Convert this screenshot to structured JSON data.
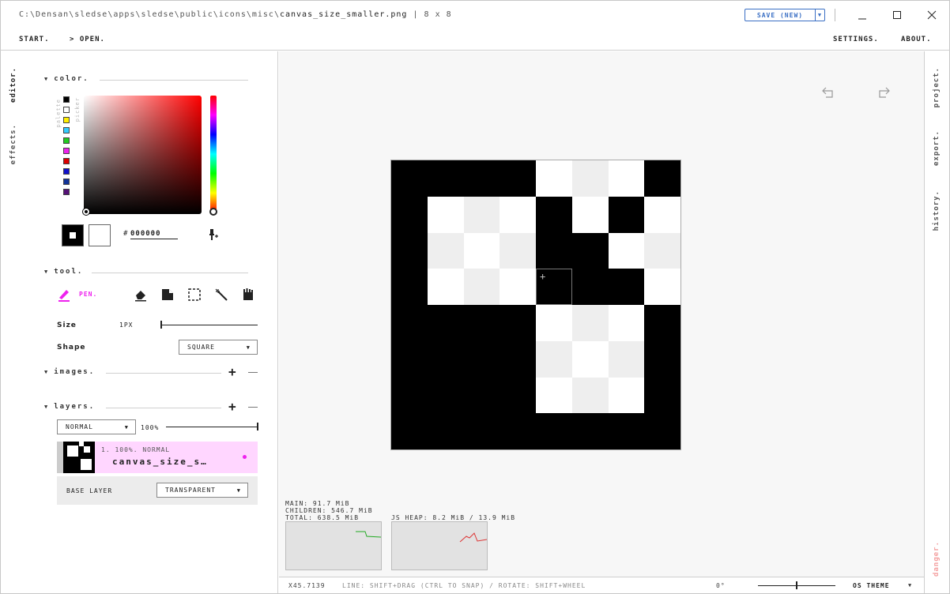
{
  "title": {
    "path_prefix": "C:\\Densan\\sledse\\apps\\sledse\\public\\icons\\misc\\",
    "filename": "canvas_size_smaller.png",
    "dimensions": "| 8 x 8"
  },
  "save": {
    "label": "SAVE (NEW)"
  },
  "window": {
    "minimize": "—",
    "maximize": "☐",
    "close": "✕"
  },
  "menu": {
    "start": "START.",
    "open": "> OPEN.",
    "settings": "SETTINGS.",
    "about": "ABOUT."
  },
  "left_nav": {
    "editor": "editor.",
    "effects": "effects."
  },
  "right_nav": {
    "project": "project.",
    "export": "export.",
    "history": "history.",
    "danger": "danger."
  },
  "color": {
    "header": "color.",
    "palette_label": "palette",
    "picker_label": "picker",
    "hex_prefix": "#",
    "hex_value": "000000",
    "palette": [
      "#000000",
      "#ffffff",
      "#ffee00",
      "#33ccff",
      "#22cc22",
      "#ee22ee",
      "#dd0000",
      "#1111cc",
      "#113399",
      "#551177"
    ]
  },
  "tool": {
    "header": "tool.",
    "active_label": "PEN.",
    "size_label": "Size",
    "size_value": "1PX",
    "shape_label": "Shape",
    "shape_value": "SQUARE"
  },
  "images": {
    "header": "images."
  },
  "layers": {
    "header": "layers.",
    "blend_mode": "NORMAL",
    "opacity": "100%",
    "layer_meta": "1. 100%. NORMAL",
    "layer_name": "canvas_size_s…",
    "base_label": "BASE LAYER",
    "base_value": "TRANSPARENT"
  },
  "memory": {
    "main": "MAIN: 91.7 MiB",
    "children": "CHILDREN: 546.7 MiB",
    "total": "TOTAL: 638.5 MiB",
    "heap": "JS HEAP: 8.2 MiB / 13.9 MiB"
  },
  "status": {
    "zoom": "X45.7139",
    "hint": "LINE: SHIFT+DRAG (CTRL TO SNAP) / ROTATE: SHIFT+WHEEL",
    "rotation": "0°",
    "theme": "OS THEME"
  },
  "pixel_grid": [
    [
      "#000",
      "#000",
      "#000",
      "#000",
      "#fff",
      "#eee",
      "#fff",
      "#000"
    ],
    [
      "#000",
      "#fff",
      "#eee",
      "#fff",
      "#000",
      "#fff",
      "#000",
      "#fff"
    ],
    [
      "#000",
      "#eee",
      "#fff",
      "#eee",
      "#000",
      "#000",
      "#fff",
      "#eee"
    ],
    [
      "#000",
      "#fff",
      "#eee",
      "#fff",
      "#000",
      "#000",
      "#000",
      "#fff"
    ],
    [
      "#000",
      "#000",
      "#000",
      "#000",
      "#fff",
      "#eee",
      "#fff",
      "#000"
    ],
    [
      "#000",
      "#000",
      "#000",
      "#000",
      "#eee",
      "#fff",
      "#eee",
      "#000"
    ],
    [
      "#000",
      "#000",
      "#000",
      "#000",
      "#fff",
      "#eee",
      "#fff",
      "#000"
    ],
    [
      "#000",
      "#000",
      "#000",
      "#000",
      "#000",
      "#000",
      "#000",
      "#000"
    ]
  ],
  "colors": {
    "accent": "#ee22ee",
    "save_blue": "#3a6fc4",
    "layer_bg": "#ffd6ff"
  }
}
